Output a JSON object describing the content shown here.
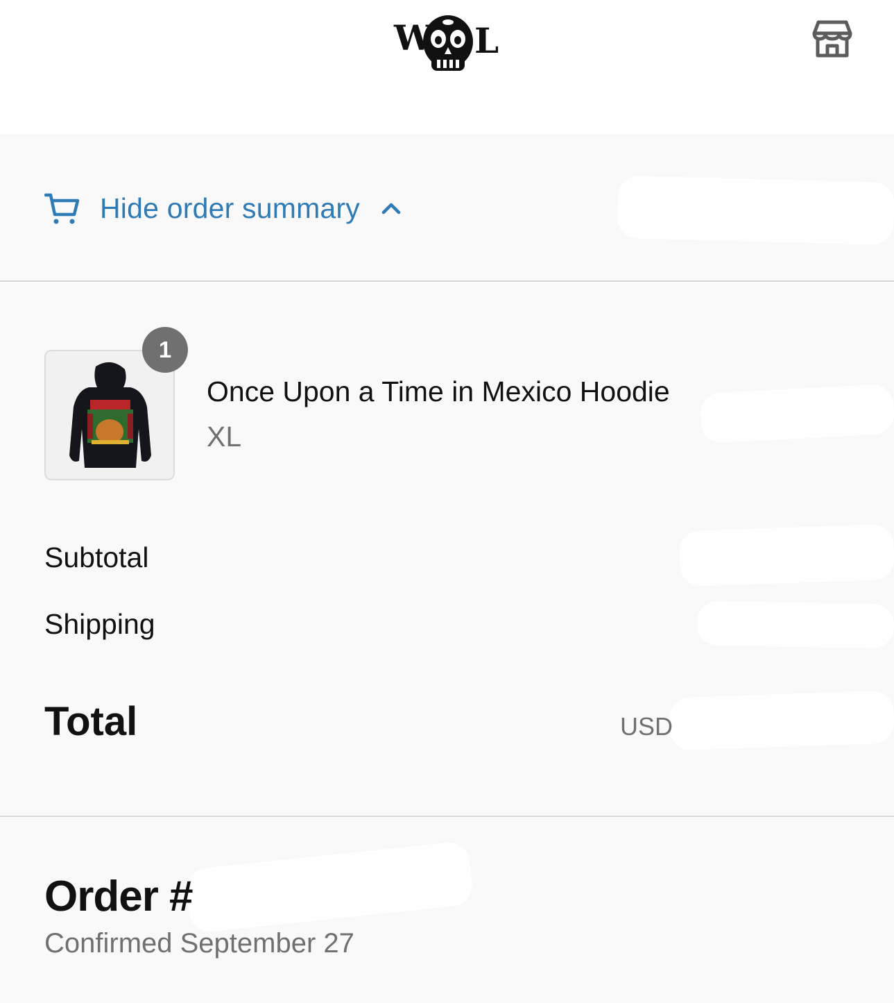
{
  "header": {
    "logo_text": "WL",
    "logo_icon": "skull-logo",
    "store_icon": "store-icon"
  },
  "summary": {
    "toggle_label": "Hide order summary",
    "cart_icon": "cart-icon",
    "chevron_icon": "chevron-up-icon",
    "accent_color": "#2e7bb5"
  },
  "cart": {
    "items": [
      {
        "quantity": "1",
        "name": "Once Upon a Time in Mexico Hoodie",
        "variant": "XL",
        "image": "hoodie-thumbnail"
      }
    ]
  },
  "totals": {
    "subtotal_label": "Subtotal",
    "shipping_label": "Shipping",
    "total_label": "Total",
    "currency": "USD"
  },
  "order": {
    "number_label": "Order #",
    "confirmed_text": "Confirmed September 27"
  }
}
